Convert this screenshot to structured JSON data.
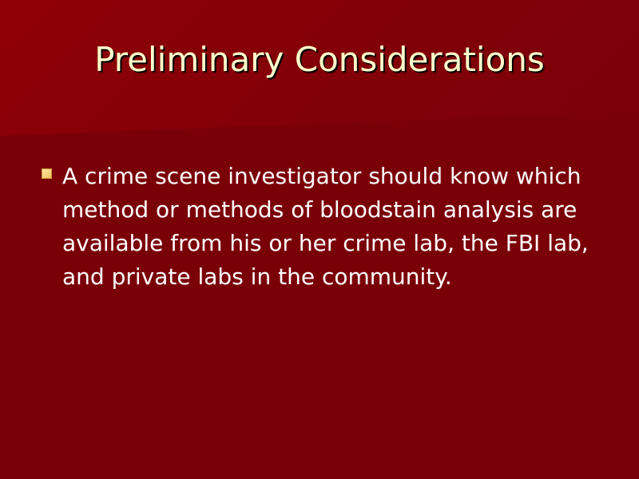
{
  "slide": {
    "title": "Preliminary Considerations",
    "bullets": [
      {
        "text": "A crime scene investigator should know which method or methods of bloodstain analysis are available from his or her crime lab, the FBI lab, and private labs in the community."
      }
    ]
  },
  "colors": {
    "background": "#7a0008",
    "title_text": "#ffffcc",
    "body_text": "#ffffff",
    "bullet": "#f0c060"
  },
  "icons": {
    "bullet": "square-bullet-icon"
  }
}
